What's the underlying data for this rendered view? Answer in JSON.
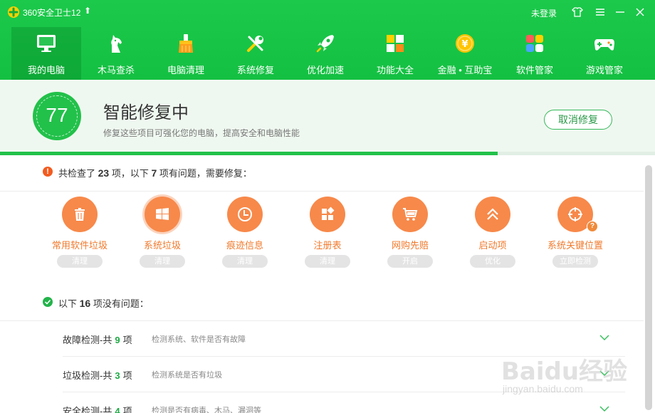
{
  "titlebar": {
    "app_title": "360安全卫士12",
    "login_label": "未登录"
  },
  "nav": {
    "items": [
      {
        "label": "我的电脑",
        "icon": "monitor-icon",
        "active": true
      },
      {
        "label": "木马查杀",
        "icon": "horse-icon"
      },
      {
        "label": "电脑清理",
        "icon": "broom-icon"
      },
      {
        "label": "系统修复",
        "icon": "wrench-icon"
      },
      {
        "label": "优化加速",
        "icon": "rocket-icon"
      },
      {
        "label": "功能大全",
        "icon": "grid-icon"
      },
      {
        "label": "金融 • 互助宝",
        "icon": "coin-icon"
      },
      {
        "label": "软件管家",
        "icon": "software-icon"
      },
      {
        "label": "游戏管家",
        "icon": "gamepad-icon"
      }
    ]
  },
  "banner": {
    "score": "77",
    "title": "智能修复中",
    "subtitle": "修复这些项目可强化您的电脑，提高安全和电脑性能",
    "cancel_label": "取消修复",
    "progress": 0.76
  },
  "problems": {
    "prefix": "共检查了",
    "total": "23",
    "mid": "项，以下",
    "count": "7",
    "suffix": "项有问题，需要修复：",
    "items": [
      {
        "label": "常用软件垃圾",
        "action": "清理",
        "icon": "trash-icon"
      },
      {
        "label": "系统垃圾",
        "action": "清理",
        "icon": "windows-icon"
      },
      {
        "label": "痕迹信息",
        "action": "清理",
        "icon": "clock-icon"
      },
      {
        "label": "注册表",
        "action": "清理",
        "icon": "registry-icon"
      },
      {
        "label": "网购先赔",
        "action": "开启",
        "icon": "cart-icon"
      },
      {
        "label": "启动项",
        "action": "优化",
        "icon": "double-chevron-up-icon"
      },
      {
        "label": "系统关键位置",
        "action": "立即检测",
        "icon": "crosshair-icon"
      }
    ]
  },
  "ok": {
    "prefix": "以下",
    "count": "16",
    "suffix": "项没有问题：",
    "categories": [
      {
        "name": "故障检测-共",
        "count": "9",
        "unit": "项",
        "desc": "检测系统、软件是否有故障"
      },
      {
        "name": "垃圾检测-共",
        "count": "3",
        "unit": "项",
        "desc": "检测系统是否有垃圾"
      },
      {
        "name": "安全检测-共",
        "count": "4",
        "unit": "项",
        "desc": "检测是否有病毒、木马、漏洞等"
      }
    ]
  },
  "watermark": {
    "main": "Baidu经验",
    "sub": "jingyan.baidu.com"
  },
  "colors": {
    "brand_green": "#14c042",
    "issue_orange": "#f7894a",
    "warn_red": "#f25b1f"
  }
}
